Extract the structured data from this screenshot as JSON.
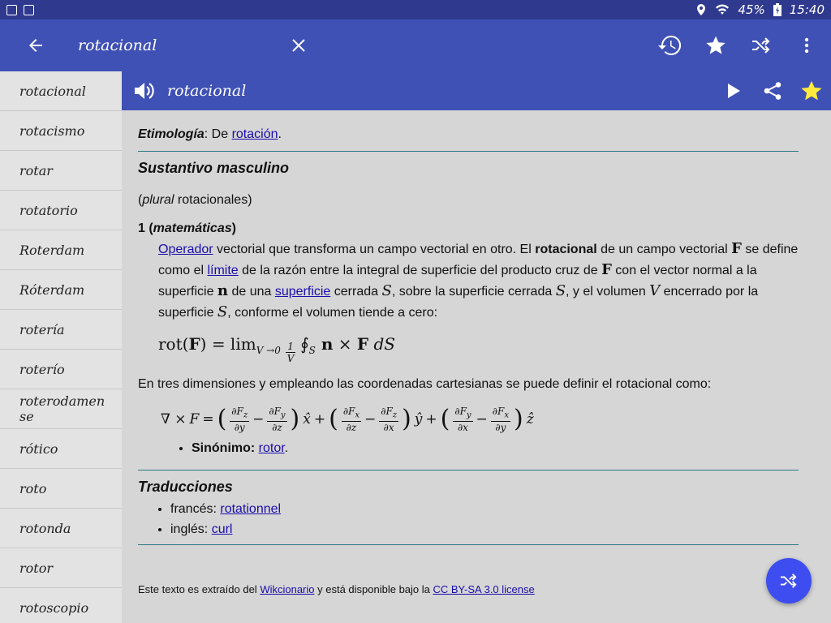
{
  "status_bar": {
    "battery": "45%",
    "time": "15:40"
  },
  "search": {
    "query": "rotacional"
  },
  "sidebar": {
    "items": [
      {
        "label": "rotacional"
      },
      {
        "label": "rotacismo"
      },
      {
        "label": "rotar"
      },
      {
        "label": "rotatorio"
      },
      {
        "label": "Roterdam"
      },
      {
        "label": "Róterdam"
      },
      {
        "label": "rotería"
      },
      {
        "label": "roterío"
      },
      {
        "label": "roterodamense"
      },
      {
        "label": "rótico"
      },
      {
        "label": "roto"
      },
      {
        "label": "rotonda"
      },
      {
        "label": "rotor"
      },
      {
        "label": "rotoscopio"
      }
    ]
  },
  "entry": {
    "word": "rotacional",
    "etymology_label": "Etimología",
    "etymology_prefix": ": De ",
    "etymology_link": "rotación",
    "etymology_suffix": ".",
    "pos": "Sustantivo masculino",
    "plural_open": "(",
    "plural_label": "plural",
    "plural_value": " rotacionales)",
    "sense_number": "1 (",
    "sense_domain": "matemáticas",
    "sense_close": ")",
    "def_link_operador": "Operador",
    "def_t1": " vectorial que transforma un campo vectorial en otro. El ",
    "def_bold": "rotacional",
    "def_t2": " de un campo vectorial ",
    "def_F": "F",
    "def_t3": " se define como el ",
    "def_link_limite": "límite",
    "def_t4": " de la razón entre la integral de superficie del producto cruz de ",
    "def_F2": "F",
    "def_t5": " con el vector normal a la superficie ",
    "def_n": "n",
    "def_t6": " de una ",
    "def_link_superficie": "superficie",
    "def_t7": " cerrada ",
    "def_S1": "S",
    "def_t8": ", sobre la superficie cerrada ",
    "def_S2": "S",
    "def_t9": ", y el volumen ",
    "def_V": "V",
    "def_t10": " encerrado por la superficie ",
    "def_S3": "S",
    "def_t11": ", conforme el volumen tiende a cero:",
    "formula_left": "rot(",
    "formula_F": "F",
    "formula_eq": ") = lim",
    "formula_sub": "V →0",
    "formula_one": "1",
    "formula_V": "V",
    "formula_oint": "∮",
    "formula_S": "S",
    "formula_n": " n",
    "formula_times": " × ",
    "formula_F2": "F",
    "formula_dS": " dS",
    "dim_text": "En tres dimensiones y empleando las coordenadas cartesianas se puede definir el rotacional como:",
    "curl": {
      "nabla": "∇ ×",
      "F": "F",
      "eq": "=",
      "dFz": "∂F",
      "z_sub": "z",
      "dy": "∂y",
      "minus": "−",
      "dFy": "∂F",
      "y_sub": "y",
      "dz": "∂z",
      "xhat": "x̂",
      "plus": "+",
      "dFx": "∂F",
      "x_sub": "x",
      "dx": "∂x",
      "yhat": "ŷ",
      "zhat": "ẑ",
      "open": "(",
      "close": ")"
    },
    "synonym_label": "Sinónimo:",
    "synonym_link": "rotor",
    "synonym_suffix": ".",
    "translations_title": "Traducciones",
    "translations": [
      {
        "lang": "francés: ",
        "word": "rotationnel"
      },
      {
        "lang": "inglés: ",
        "word": "curl"
      }
    ],
    "footer_t1": "Este texto es extraído del ",
    "footer_link1": "Wikcionario",
    "footer_t2": " y está disponible bajo la ",
    "footer_link2": "CC BY-SA 3.0 license"
  },
  "colors": {
    "appbar": "#3f51b5",
    "statusbar": "#2f3a8f",
    "fab": "#3d4df0",
    "star_active": "#ffeb3b"
  }
}
